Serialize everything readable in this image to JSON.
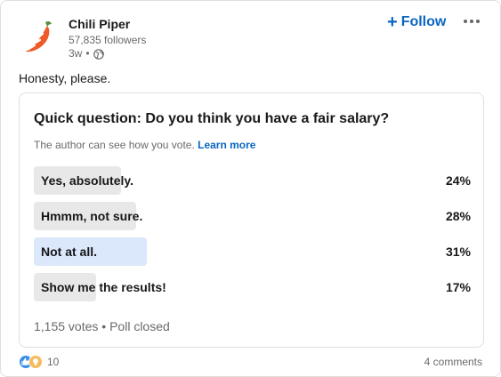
{
  "post": {
    "company_name": "Chili Piper",
    "followers": "57,835 followers",
    "time_ago": "3w",
    "time_separator": "•",
    "visibility_icon": "globe-icon",
    "follow_label": "Follow",
    "follow_icon": "plus-icon",
    "more_icon": "ellipsis-icon",
    "text": "Honesty, please.",
    "brand_color": "#0a66c2",
    "logo_color": "#f05a28"
  },
  "poll": {
    "question": "Quick question: Do you think you have a fair salary?",
    "visibility_note": "The author can see how you vote.",
    "learn_more": "Learn more",
    "options": [
      {
        "label": "Yes, absolutely.",
        "percent": "24%",
        "value": 0.24,
        "selected": false
      },
      {
        "label": "Hmmm, not sure.",
        "percent": "28%",
        "value": 0.28,
        "selected": false
      },
      {
        "label": "Not at all.",
        "percent": "31%",
        "value": 0.31,
        "selected": true
      },
      {
        "label": "Show me the results!",
        "percent": "17%",
        "value": 0.17,
        "selected": false
      }
    ],
    "votes": "1,155 votes",
    "footer_separator": "•",
    "status": "Poll closed"
  },
  "social": {
    "reaction_icons": [
      "like-icon",
      "insightful-icon"
    ],
    "reaction_count": "10",
    "comments": "4 comments"
  }
}
